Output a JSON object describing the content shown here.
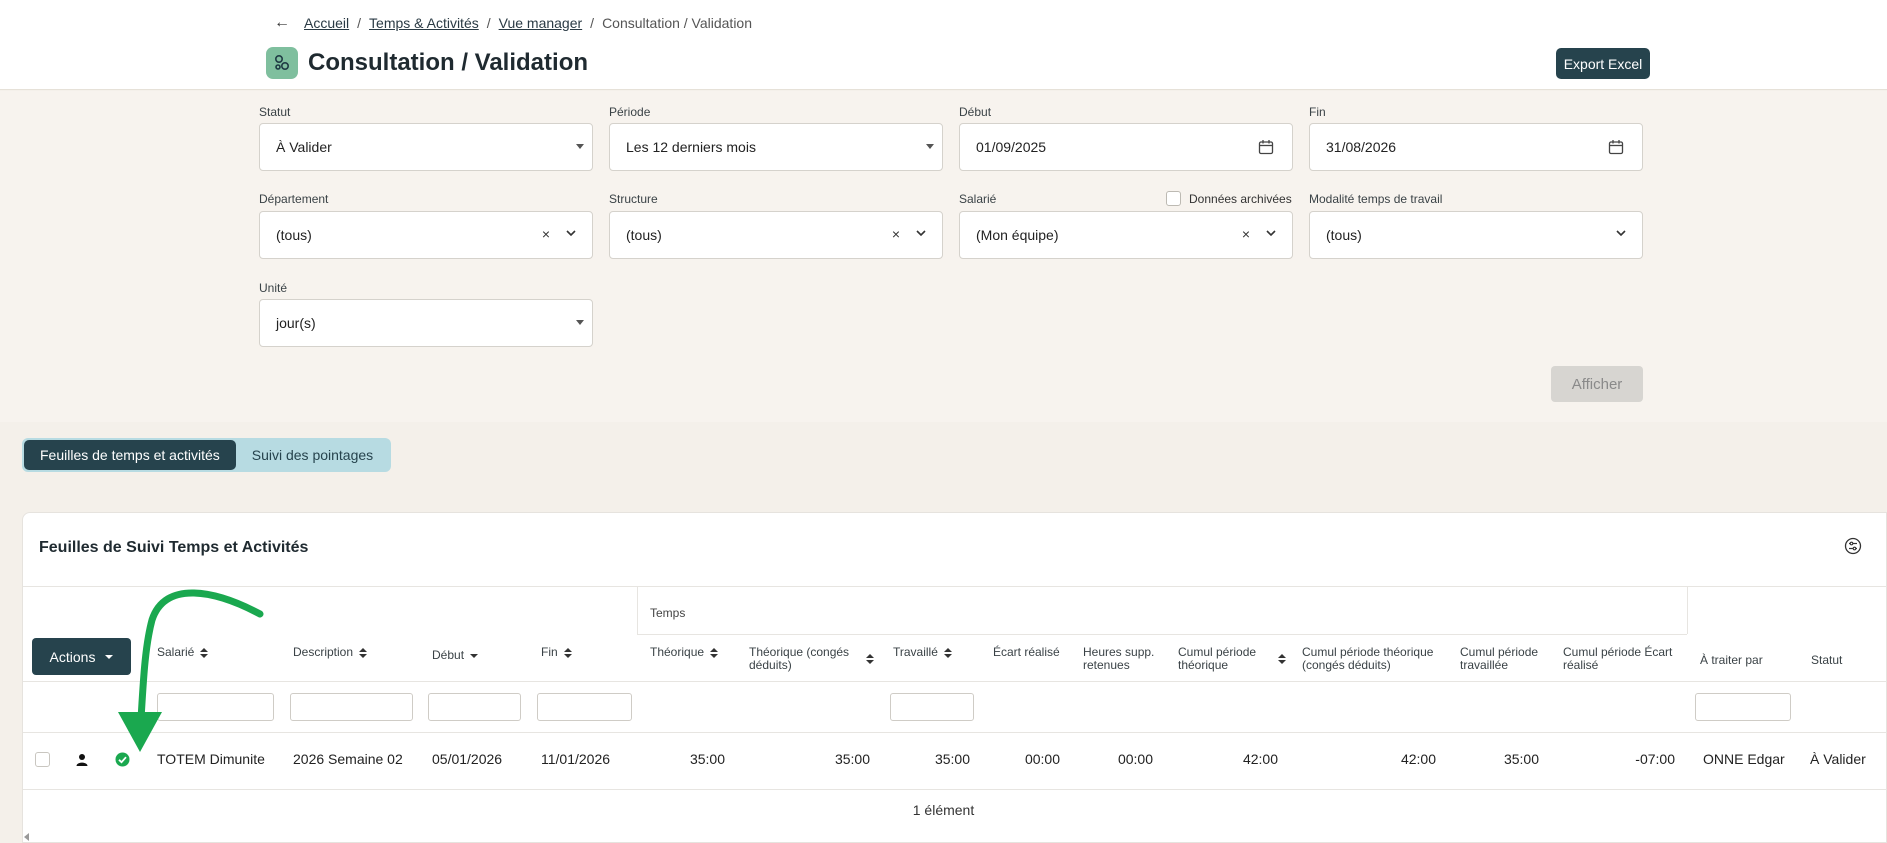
{
  "breadcrumb": {
    "items": [
      "Accueil",
      "Temps & Activités",
      "Vue manager"
    ],
    "current": "Consultation / Validation"
  },
  "page": {
    "title": "Consultation / Validation",
    "export_label": "Export Excel"
  },
  "filters": {
    "statut": {
      "label": "Statut",
      "value": "À Valider"
    },
    "periode": {
      "label": "Période",
      "value": "Les 12 derniers mois"
    },
    "debut": {
      "label": "Début",
      "value": "01/09/2025"
    },
    "fin": {
      "label": "Fin",
      "value": "31/08/2026"
    },
    "departement": {
      "label": "Département",
      "value": "(tous)"
    },
    "structure": {
      "label": "Structure",
      "value": "(tous)"
    },
    "salarie": {
      "label": "Salarié",
      "value": "(Mon équipe)"
    },
    "archives_label": "Données archivées",
    "modalite": {
      "label": "Modalité temps de travail",
      "value": "(tous)"
    },
    "unite": {
      "label": "Unité",
      "value": "jour(s)"
    },
    "submit_label": "Afficher"
  },
  "tabs": [
    {
      "label": "Feuilles de temps et activités",
      "active": true
    },
    {
      "label": "Suivi des pointages",
      "active": false
    }
  ],
  "table": {
    "title": "Feuilles de Suivi Temps et Activités",
    "group_label": "Temps",
    "actions_label": "Actions",
    "columns": {
      "salarie": "Salarié",
      "description": "Description",
      "debut": "Début",
      "fin": "Fin",
      "theorique": "Théorique",
      "theorique_conges": "Théorique (congés déduits)",
      "travaille": "Travaillé",
      "ecart": "Écart réalisé",
      "heures_supp": "Heures supp. retenues",
      "cumul_theorique": "Cumul période théorique",
      "cumul_theorique_conges": "Cumul période théorique (congés déduits)",
      "cumul_travaillee": "Cumul période travaillée",
      "cumul_ecart": "Cumul période Écart réalisé",
      "a_traiter": "À traiter par",
      "statut": "Statut"
    },
    "rows": [
      {
        "salarie": "TOTEM Dimunite",
        "description": "2026 Semaine 02",
        "debut": "05/01/2026",
        "fin": "11/01/2026",
        "theorique": "35:00",
        "theorique_conges": "35:00",
        "travaille": "35:00",
        "ecart": "00:00",
        "heures_supp": "00:00",
        "cumul_theorique": "42:00",
        "cumul_theorique_conges": "42:00",
        "cumul_travaillee": "35:00",
        "cumul_ecart": "-07:00",
        "a_traiter": "ONNE Edgar",
        "statut": "À Valider"
      }
    ],
    "count_label": "1 élément"
  },
  "colors": {
    "primary": "#26434d",
    "accent_green": "#1aa84f",
    "tab_bg": "#b7dbe2"
  }
}
